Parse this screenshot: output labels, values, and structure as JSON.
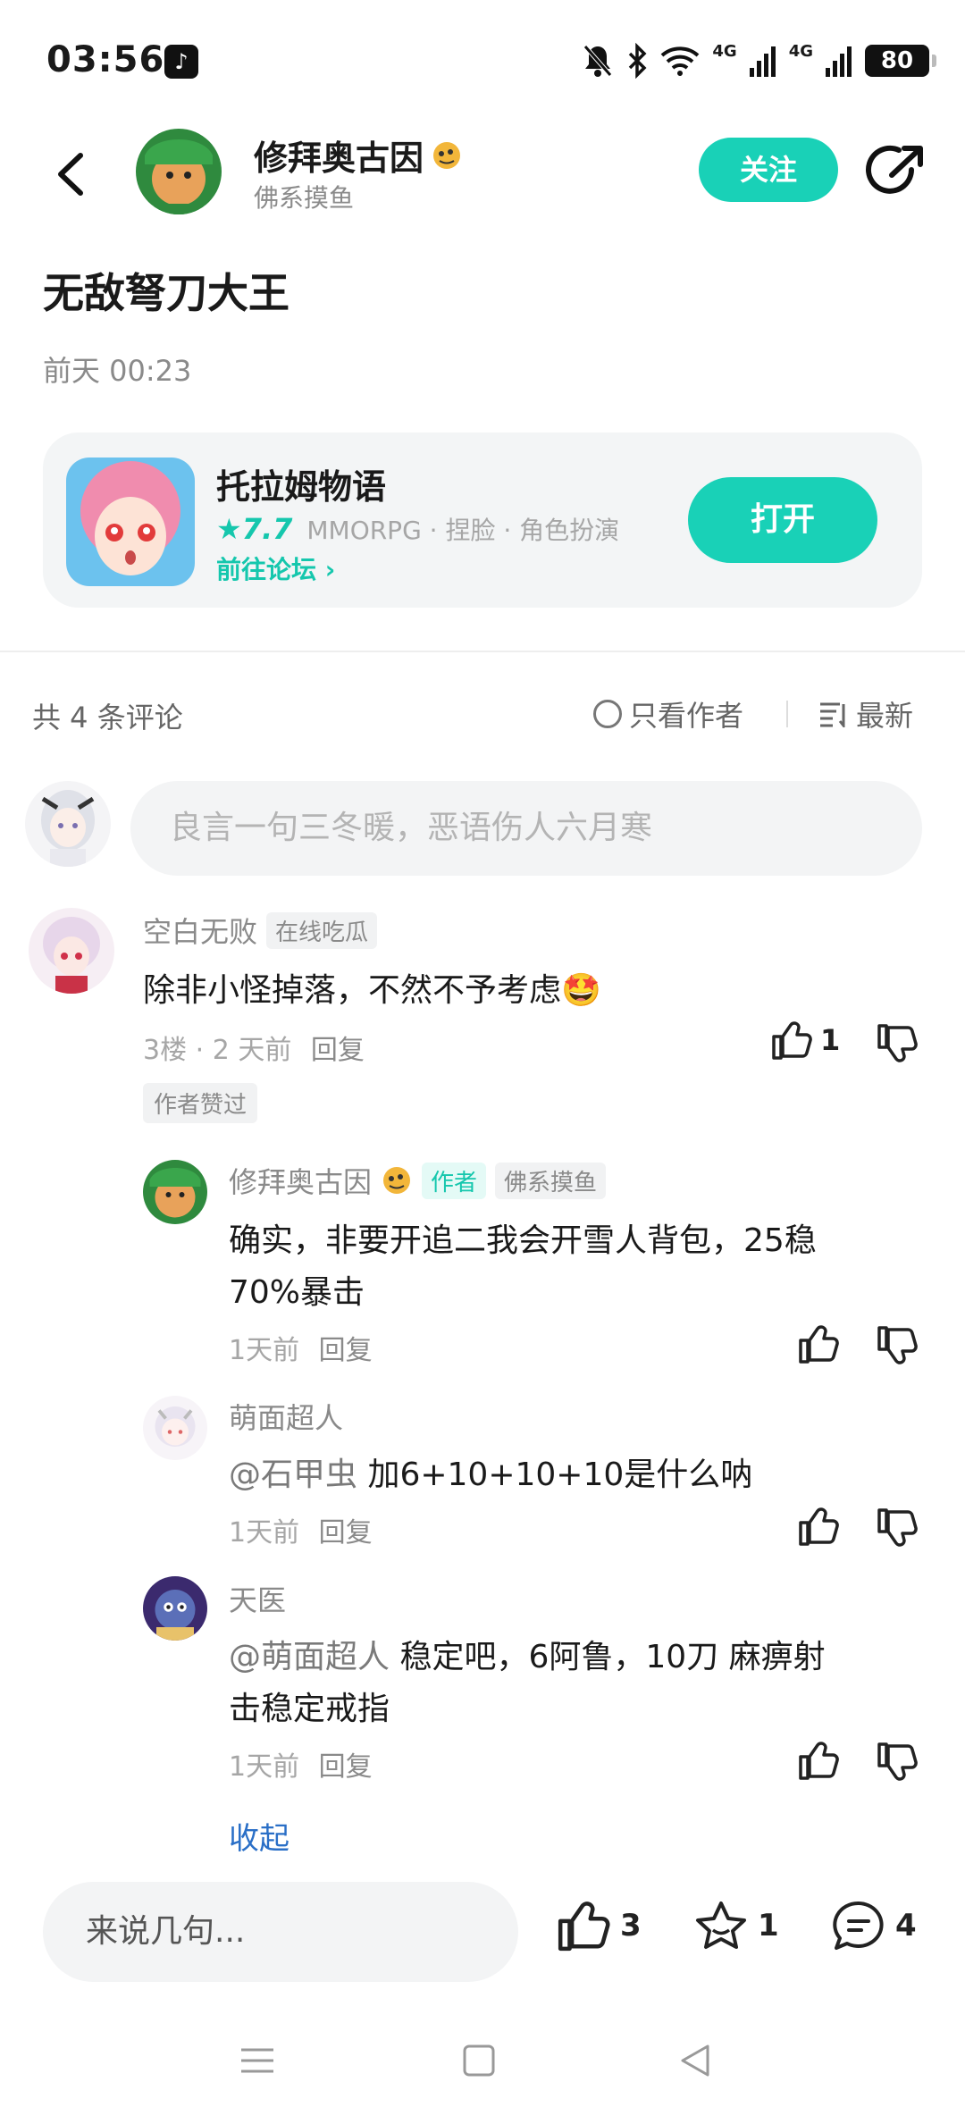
{
  "status_bar": {
    "time": "03:56",
    "battery": "80",
    "net_1": "4G",
    "net_2": "4G"
  },
  "header": {
    "username": "修拜奥古因",
    "subtitle": "佛系摸鱼",
    "follow_label": "关注"
  },
  "post": {
    "title": "无敌弩刀大王",
    "time": "前天 00:23"
  },
  "game_card": {
    "name": "托拉姆物语",
    "score": "★7.7",
    "tags": "MMORPG · 捏脸 · 角色扮演",
    "forum_link": "前往论坛 ›",
    "open_label": "打开"
  },
  "comments_header": {
    "count": "共 4 条评论",
    "author_only": "只看作者",
    "sort": "最新",
    "input_placeholder": "良言一句三冬暖，恶语伤人六月寒"
  },
  "comments": [
    {
      "name": "空白无败",
      "badge": "在线吃瓜",
      "text": "除非小怪掉落，不然不予考虑🤩",
      "meta": "3楼 · 2 天前",
      "reply": "回复",
      "likes": "1",
      "liked_tag": "作者赞过"
    }
  ],
  "replies": [
    {
      "name": "修拜奥古因",
      "author_tag": "作者",
      "badge": "佛系摸鱼",
      "text_line1": "确实，非要开追二我会开雪人背包，25稳",
      "text_line2": "70%暴击",
      "time": "1天前",
      "reply": "回复"
    },
    {
      "name": "萌面超人",
      "mention": "@石甲虫",
      "text": " 加6+10+10+10是什么呐",
      "time": "1天前",
      "reply": "回复"
    },
    {
      "name": "天医",
      "mention": "@萌面超人",
      "text_line1": " 稳定吧，6阿鲁，10刀 麻痹射",
      "text_line2": "击稳定戒指",
      "time": "1天前",
      "reply": "回复"
    }
  ],
  "collapse_label": "收起",
  "bottom_bar": {
    "input_placeholder": "来说几句...",
    "likes": "3",
    "favorites": "1",
    "comments": "4"
  },
  "colors": {
    "accent": "#19d1b7",
    "link": "#2a6fc7"
  }
}
